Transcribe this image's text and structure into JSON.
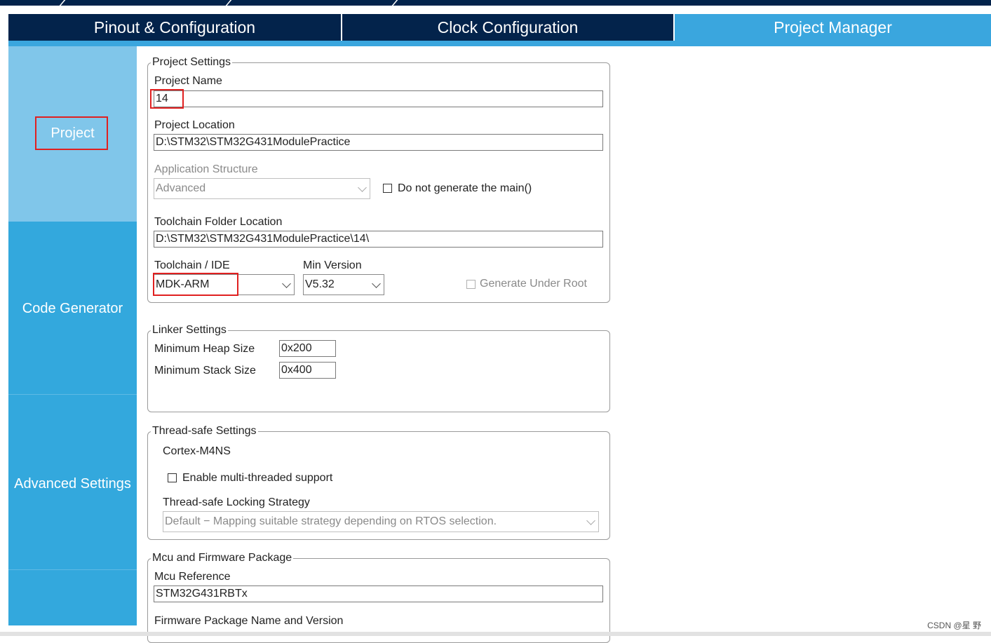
{
  "tabs": [
    {
      "label": "Pinout & Configuration"
    },
    {
      "label": "Clock Configuration"
    },
    {
      "label": "Project Manager"
    }
  ],
  "sidebar": {
    "items": [
      {
        "label": "Project"
      },
      {
        "label": "Code Generator"
      },
      {
        "label": "Advanced Settings"
      }
    ]
  },
  "project_settings": {
    "legend": "Project Settings",
    "name_label": "Project Name",
    "name_value": "14",
    "location_label": "Project Location",
    "location_value": "D:\\STM32\\STM32G431ModulePractice",
    "app_structure_label": "Application Structure",
    "app_structure_value": "Advanced",
    "no_main_label": "Do not generate the main()",
    "toolchain_folder_label": "Toolchain Folder Location",
    "toolchain_folder_value": "D:\\STM32\\STM32G431ModulePractice\\14\\",
    "toolchain_label": "Toolchain / IDE",
    "toolchain_value": "MDK-ARM",
    "min_version_label": "Min Version",
    "min_version_value": "V5.32",
    "gen_under_root_label": "Generate Under Root"
  },
  "linker_settings": {
    "legend": "Linker Settings",
    "heap_label": "Minimum Heap Size",
    "heap_value": "0x200",
    "stack_label": "Minimum Stack Size",
    "stack_value": "0x400"
  },
  "thread_safe": {
    "legend": "Thread-safe Settings",
    "core": "Cortex-M4NS",
    "multithread_label": "Enable multi-threaded support",
    "strategy_label": "Thread-safe Locking Strategy",
    "strategy_value": "Default  −  Mapping suitable strategy depending on RTOS selection."
  },
  "mcu_package": {
    "legend": "Mcu and Firmware Package",
    "mcu_ref_label": "Mcu Reference",
    "mcu_ref_value": "STM32G431RBTx",
    "fw_label": "Firmware Package Name and Version"
  },
  "watermark": "CSDN @星 野",
  "colors": {
    "tab_dark": "#03234b",
    "tab_active": "#3aa6de",
    "sidebar_active": "#80c6ea",
    "sidebar": "#33a8dd",
    "highlight": "#e02020"
  }
}
